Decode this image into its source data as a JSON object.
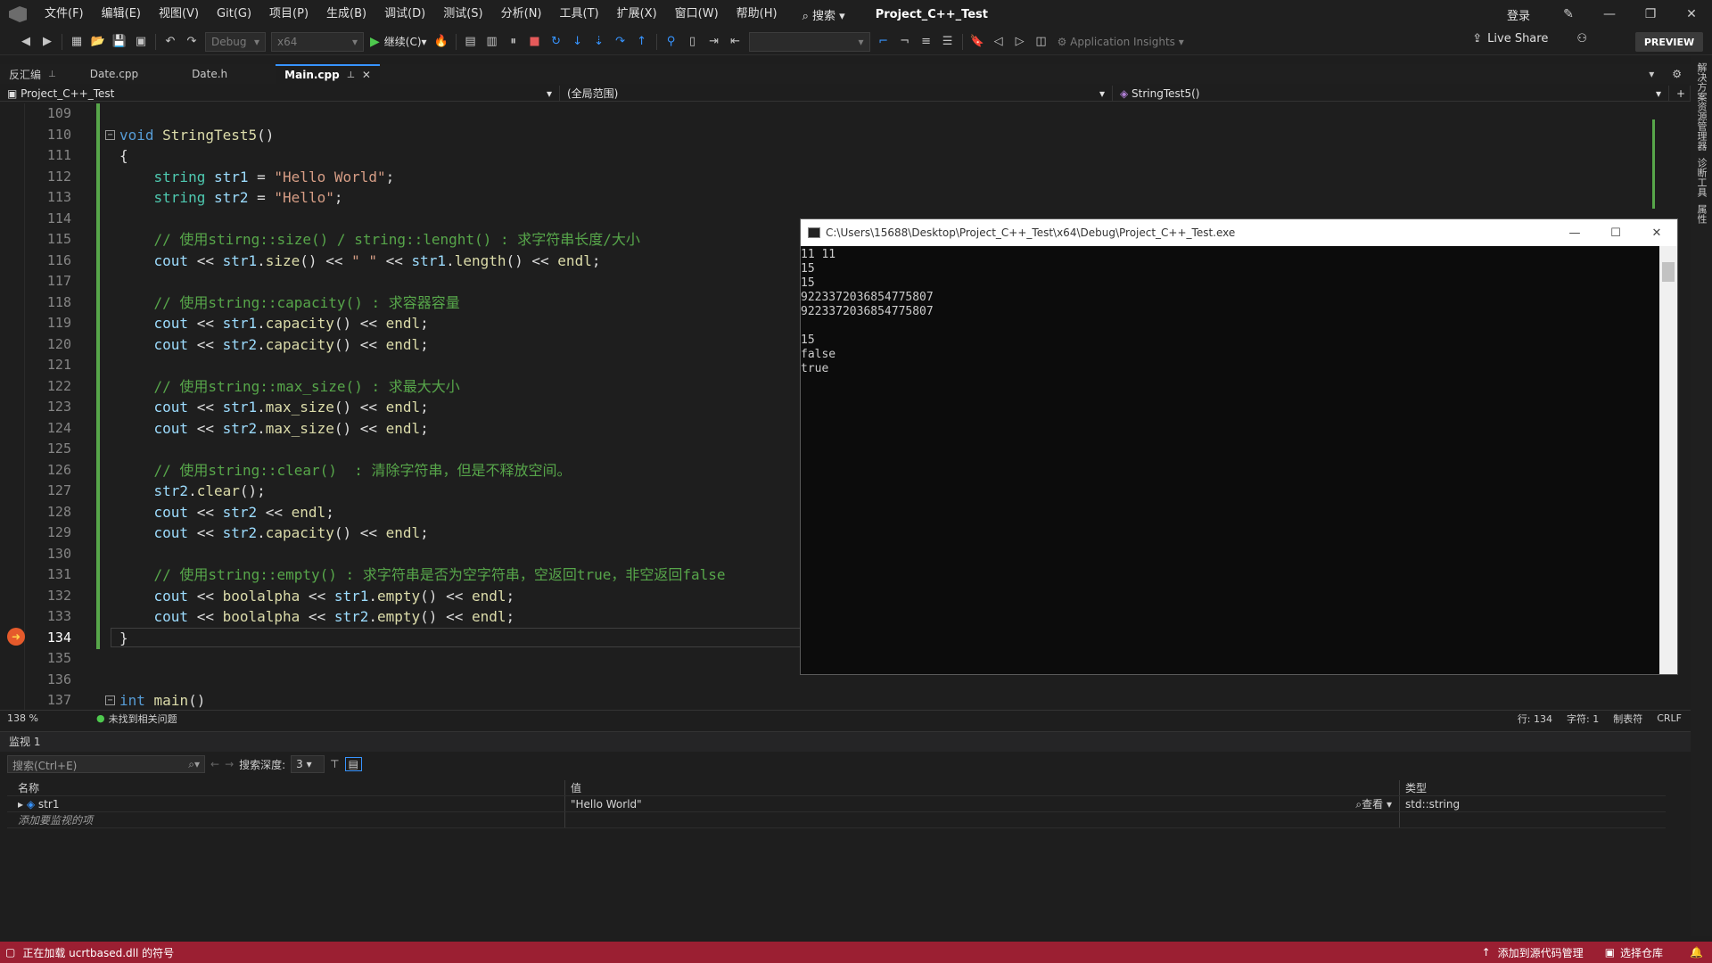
{
  "menubar": {
    "items": [
      "文件(F)",
      "编辑(E)",
      "视图(V)",
      "Git(G)",
      "项目(P)",
      "生成(B)",
      "调试(D)",
      "测试(S)",
      "分析(N)",
      "工具(T)",
      "扩展(X)",
      "窗口(W)",
      "帮助(H)"
    ],
    "search": "搜索",
    "title": "Project_C++_Test",
    "login": "登录"
  },
  "toolbar": {
    "config": "Debug",
    "platform": "x64",
    "continue": "继续(C)",
    "app_insights": "Application Insights",
    "live_share": "Live Share",
    "preview": "PREVIEW"
  },
  "tabs": [
    {
      "label": "反汇编"
    },
    {
      "label": "Date.cpp"
    },
    {
      "label": "Date.h"
    },
    {
      "label": "Main.cpp"
    }
  ],
  "navbar": {
    "project": "Project_C++_Test",
    "scope": "(全局范围)",
    "function": "StringTest5()"
  },
  "right_sidebar": [
    "解决方案资源管理器",
    "诊断工具",
    "属性"
  ],
  "editor": {
    "line_numbers": [
      "109",
      "110",
      "111",
      "112",
      "113",
      "114",
      "115",
      "116",
      "117",
      "118",
      "119",
      "120",
      "121",
      "122",
      "123",
      "124",
      "125",
      "126",
      "127",
      "128",
      "129",
      "130",
      "131",
      "132",
      "133",
      "134",
      "135",
      "136",
      "137"
    ],
    "current_line": "134"
  },
  "console": {
    "title": "C:\\Users\\15688\\Desktop\\Project_C++_Test\\x64\\Debug\\Project_C++_Test.exe",
    "lines": [
      "11 11",
      "15",
      "15",
      "9223372036854775807",
      "9223372036854775807",
      "",
      "15",
      "false",
      "true"
    ]
  },
  "editor_status": {
    "zoom": "138 %",
    "issues": "未找到相关问题",
    "line": "行: 134",
    "char": "字符: 1",
    "tab": "制表符",
    "eol": "CRLF"
  },
  "watch": {
    "title": "监视 1",
    "search_placeholder": "搜索(Ctrl+E)",
    "depth_label": "搜索深度:",
    "depth_value": "3",
    "headers": {
      "name": "名称",
      "value": "值",
      "type": "类型"
    },
    "rows": [
      {
        "name": "str1",
        "value": "\"Hello World\"",
        "type": "std::string"
      }
    ],
    "view_label": "查看",
    "add_item": "添加要监视的项"
  },
  "statusbar": {
    "loading": "正在加载 ucrtbased.dll 的符号",
    "add_source": "添加到源代码管理",
    "select_repo": "选择仓库"
  },
  "colors": {
    "accent": "#3794ff",
    "status_bar": "#9b1f32",
    "comment": "#57a64a",
    "keyword": "#569cd6",
    "string": "#d69d85"
  }
}
